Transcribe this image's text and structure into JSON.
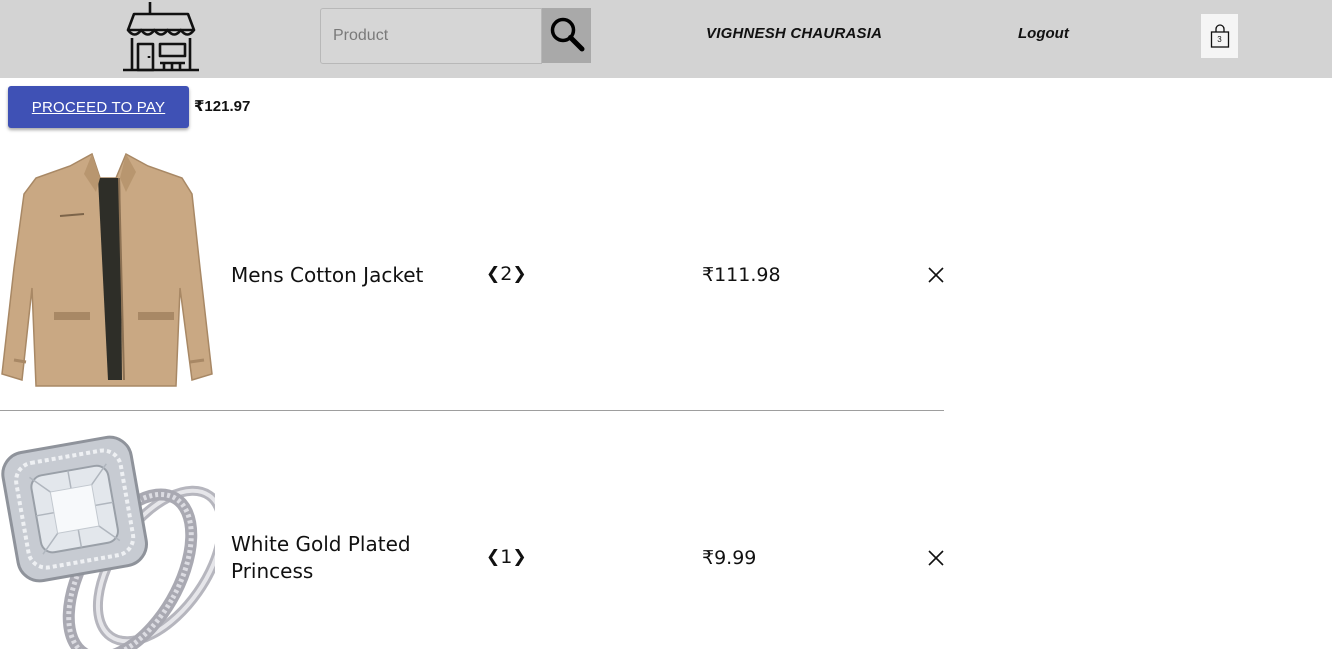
{
  "header": {
    "logo_icon": "storefront-icon",
    "search": {
      "placeholder": "Product",
      "value": "",
      "icon": "magnifier-icon"
    },
    "user_name": "VIGHNESH CHAURASIA",
    "logout_label": "Logout",
    "cart": {
      "icon": "shopping-bag-icon",
      "count": "3"
    }
  },
  "checkout": {
    "pay_label": "PROCEED TO PAY",
    "total": "₹121.97",
    "accent_color": "#3f51b5"
  },
  "cart_items": [
    {
      "image": "jacket-photo",
      "name": "Mens Cotton Jacket",
      "qty_prev": "❮",
      "qty": "2",
      "qty_next": "❯",
      "price": "₹111.98",
      "remove_icon": "close-icon"
    },
    {
      "image": "ring-photo",
      "name": "White Gold Plated Princess",
      "qty_prev": "❮",
      "qty": "1",
      "qty_next": "❯",
      "price": "₹9.99",
      "remove_icon": "close-icon"
    }
  ]
}
